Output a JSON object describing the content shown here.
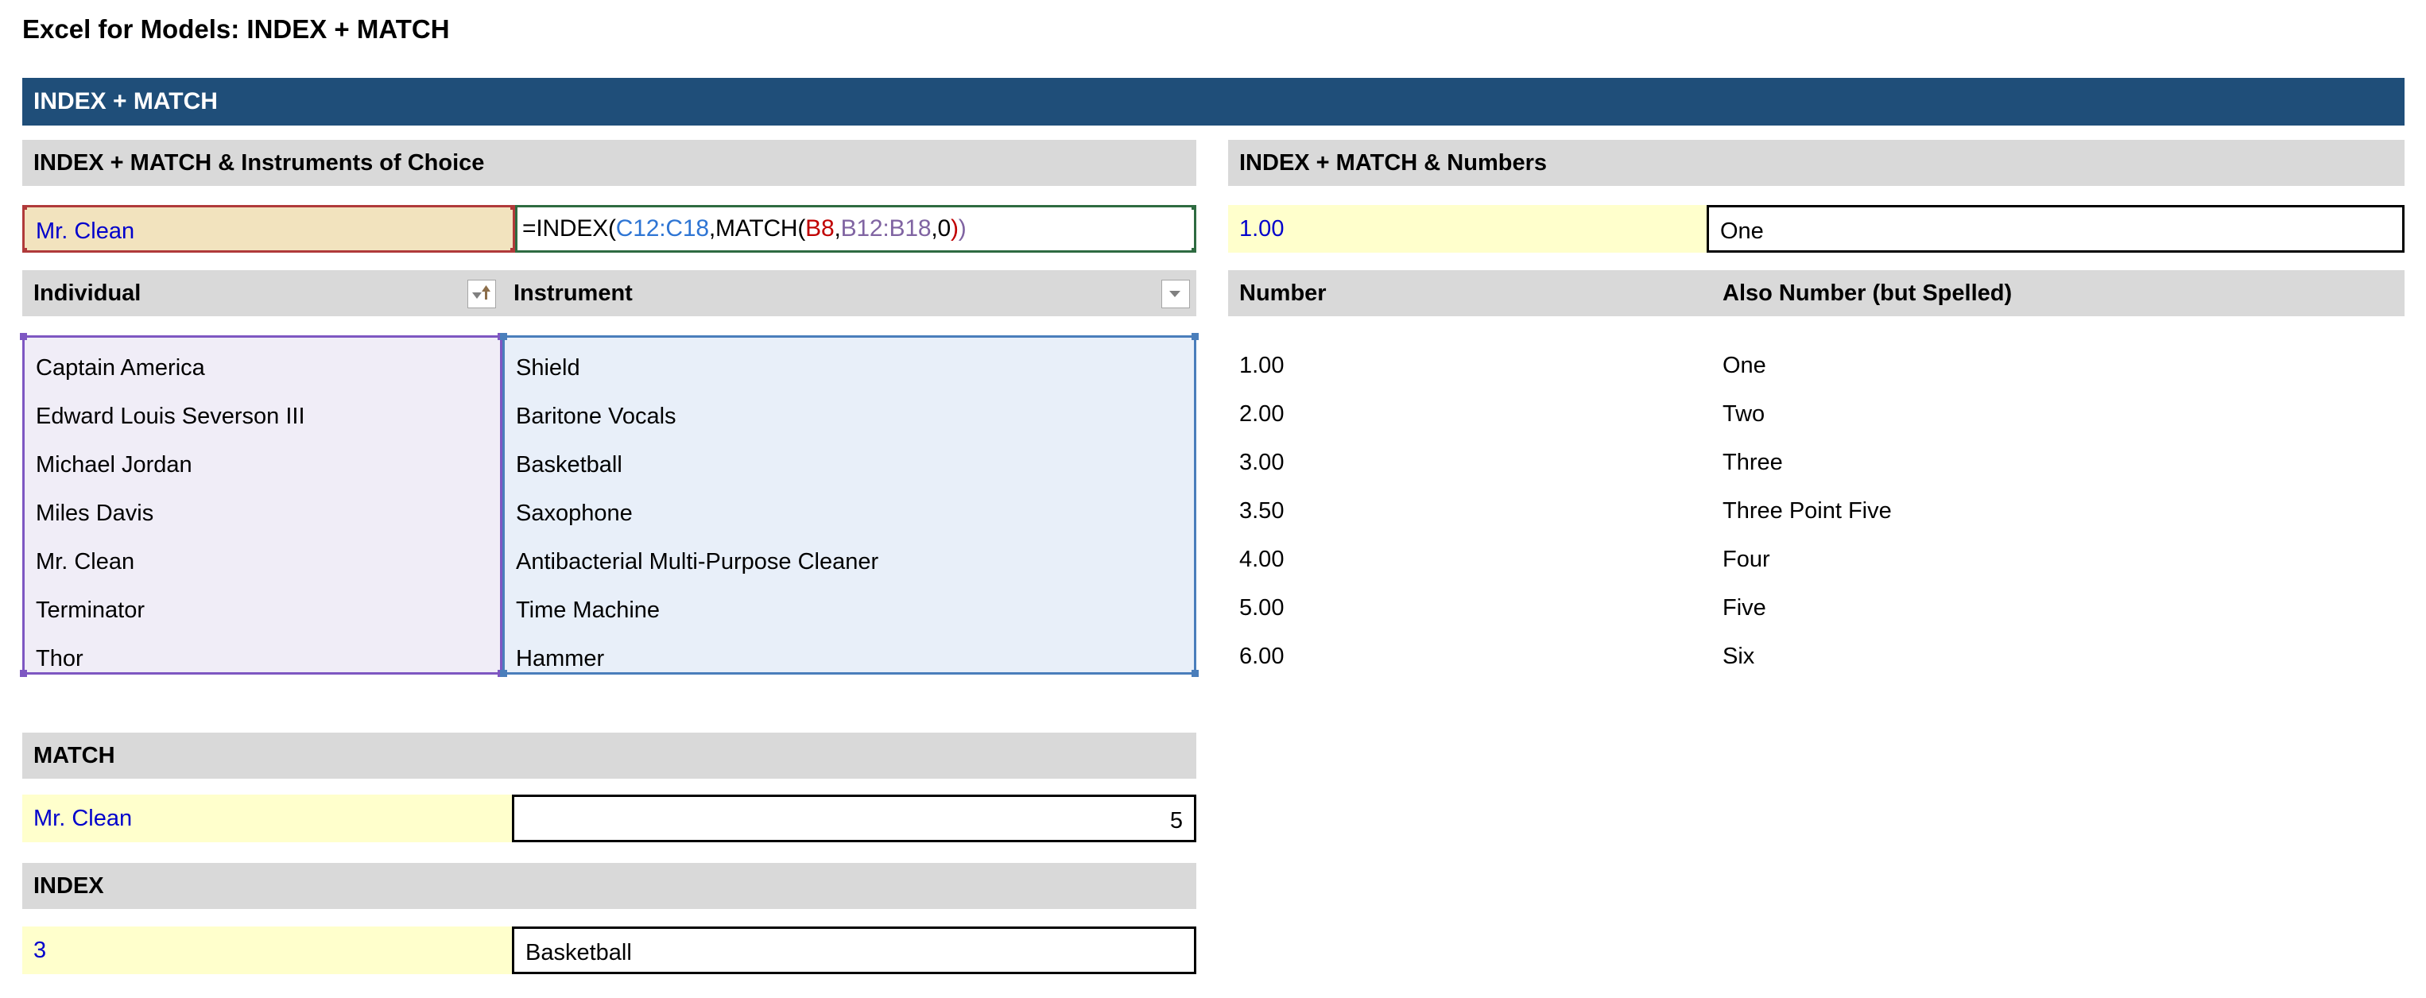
{
  "page_title": "Excel for Models: INDEX + MATCH",
  "banner": {
    "label": "INDEX + MATCH",
    "color": "#1F4E79"
  },
  "left_panel": {
    "section_header": "INDEX + MATCH & Instruments of Choice",
    "lookup_row": {
      "input_value": "Mr. Clean",
      "formula_display": "=INDEX(C12:C18,MATCH(B8,B12:B18,0))",
      "formula_tokens": [
        {
          "text": "=INDEX(",
          "color": "#000000"
        },
        {
          "text": "C12:C18",
          "color": "#2E75D4"
        },
        {
          "text": ",MATCH(",
          "color": "#000000"
        },
        {
          "text": "B8",
          "color": "#C00000"
        },
        {
          "text": ",",
          "color": "#000000"
        },
        {
          "text": "B12:B18",
          "color": "#8064A2"
        },
        {
          "text": ",0",
          "color": "#000000"
        },
        {
          "text": ")",
          "color": "#C00000"
        },
        {
          "text": ")",
          "color": "#8064A2"
        }
      ]
    },
    "table": {
      "headers": [
        "Individual",
        "Instrument"
      ],
      "header_buttons": [
        "sort-ascending-filter-icon",
        "filter-dropdown-icon"
      ],
      "rows": [
        {
          "individual": "Captain America",
          "instrument": "Shield"
        },
        {
          "individual": "Edward Louis Severson III",
          "instrument": "Baritone Vocals"
        },
        {
          "individual": "Michael Jordan",
          "instrument": "Basketball"
        },
        {
          "individual": "Miles Davis",
          "instrument": "Saxophone"
        },
        {
          "individual": "Mr. Clean",
          "instrument": "Antibacterial Multi-Purpose Cleaner"
        },
        {
          "individual": "Terminator",
          "instrument": "Time Machine"
        },
        {
          "individual": "Thor",
          "instrument": "Hammer"
        }
      ]
    },
    "match_section": {
      "header": "MATCH",
      "input_value": "Mr. Clean",
      "result_value": "5"
    },
    "index_section": {
      "header": "INDEX",
      "input_value": "3",
      "result_value": "Basketball"
    }
  },
  "right_panel": {
    "section_header": "INDEX + MATCH & Numbers",
    "lookup_row": {
      "input_value": "1.00",
      "result_value": "One"
    },
    "table": {
      "headers": [
        "Number",
        "Also Number (but Spelled)"
      ],
      "rows": [
        {
          "number": "1.00",
          "spelled": "One"
        },
        {
          "number": "2.00",
          "spelled": "Two"
        },
        {
          "number": "3.00",
          "spelled": "Three"
        },
        {
          "number": "3.50",
          "spelled": "Three Point Five"
        },
        {
          "number": "4.00",
          "spelled": "Four"
        },
        {
          "number": "5.00",
          "spelled": "Five"
        },
        {
          "number": "6.00",
          "spelled": "Six"
        }
      ]
    }
  },
  "colors": {
    "banner": "#1F4E79",
    "section_header_fill": "#D9D9D9",
    "input_fill": "#F2E3BE",
    "yellow_fill": "#FFFFCC",
    "input_text": "#0000CC",
    "trace_red": "#B03A3A",
    "trace_green": "#2E6B41",
    "trace_purple": "#7E57C2",
    "trace_blue": "#4A7EBB",
    "formula_ref_blue": "#2E75D4",
    "formula_ref_red": "#C00000",
    "formula_ref_purple": "#8064A2",
    "range_fill_lavender": "#F0EDF7",
    "range_fill_blue": "#E8EFF9"
  }
}
